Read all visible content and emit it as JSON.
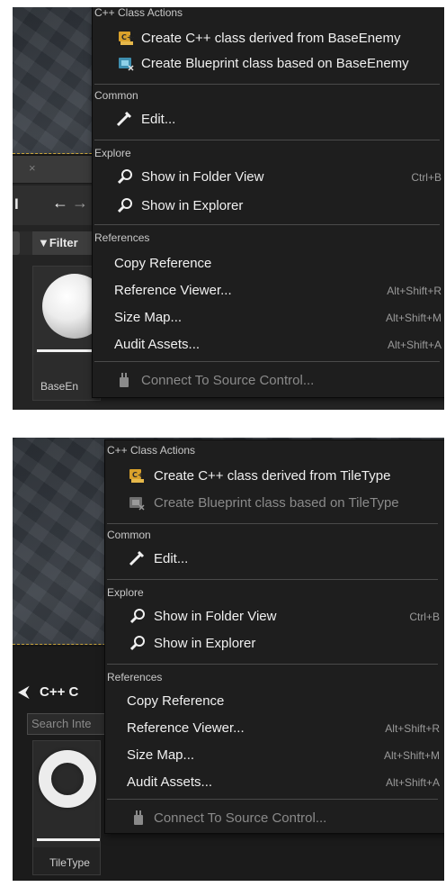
{
  "shot1": {
    "panel": {
      "tab_close": "×",
      "toolbar_glyph": "I",
      "back_arrow": "←",
      "forward_arrow": "→",
      "filter_label": "▼Filter",
      "asset_label": "BaseEn"
    },
    "menu": {
      "cpp_header": "C++ Class Actions",
      "create_cpp": "Create C++ class derived from BaseEnemy",
      "create_bp": "Create Blueprint class based on BaseEnemy",
      "common_header": "Common",
      "edit": "Edit...",
      "explore_header": "Explore",
      "show_folder": "Show in Folder View",
      "show_folder_shortcut": "Ctrl+B",
      "show_explorer": "Show in Explorer",
      "references_header": "References",
      "copy_ref": "Copy Reference",
      "ref_viewer": "Reference Viewer...",
      "ref_viewer_shortcut": "Alt+Shift+R",
      "size_map": "Size Map...",
      "size_map_shortcut": "Alt+Shift+M",
      "audit": "Audit Assets...",
      "audit_shortcut": "Alt+Shift+A",
      "source_control": "Connect To Source Control..."
    }
  },
  "shot2": {
    "panel": {
      "folder_glyph": "⮜",
      "path_label": "C++ C",
      "right_glyph": "‹",
      "search_placeholder": "Search Inte",
      "asset_label": "TileType"
    },
    "menu": {
      "cpp_header": "C++ Class Actions",
      "create_cpp": "Create C++ class derived from TileType",
      "create_bp": "Create Blueprint class based on TileType",
      "common_header": "Common",
      "edit": "Edit...",
      "explore_header": "Explore",
      "show_folder": "Show in Folder View",
      "show_folder_shortcut": "Ctrl+B",
      "show_explorer": "Show in Explorer",
      "references_header": "References",
      "copy_ref": "Copy Reference",
      "ref_viewer": "Reference Viewer...",
      "ref_viewer_shortcut": "Alt+Shift+R",
      "size_map": "Size Map...",
      "size_map_shortcut": "Alt+Shift+M",
      "audit": "Audit Assets...",
      "audit_shortcut": "Alt+Shift+A",
      "source_control": "Connect To Source Control..."
    }
  },
  "colors": {
    "menu_bg": "#1e1e1e",
    "text": "#f0f0f0",
    "shortcut": "#9a9a9a",
    "disabled": "#8a8a8a",
    "viewport_edge": "#c9a43a"
  },
  "icons": {
    "cpp": "cpp-class-icon",
    "blueprint": "blueprint-class-icon",
    "edit": "edit-icon",
    "folder_view": "magnifier-icon",
    "explorer": "magnifier-icon",
    "source_control": "plug-icon"
  }
}
